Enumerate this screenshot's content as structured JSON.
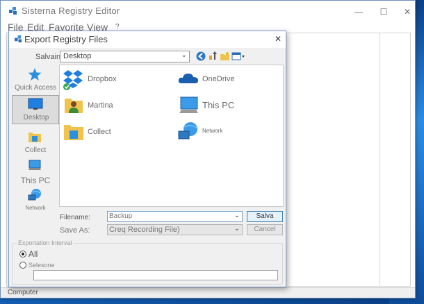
{
  "main_window": {
    "title": "Sisterna Registry Editor",
    "menu": [
      "File",
      "Edit",
      "Favorite",
      "View",
      "?"
    ],
    "controls": {
      "minimize": "—",
      "maximize": "☐",
      "close": "✕"
    },
    "status": "Computer"
  },
  "dialog": {
    "title": "Export Registry Files",
    "close": "✕",
    "save_in_label": "Salvain",
    "save_in_value": "Desktop",
    "places": [
      {
        "label": "Quick Access",
        "icon": "star-icon"
      },
      {
        "label": "Desktop",
        "icon": "desktop-icon"
      },
      {
        "label": "Collect",
        "icon": "library-icon"
      },
      {
        "label": "This PC",
        "icon": "computer-icon"
      },
      {
        "label": "Network",
        "icon": "network-icon"
      }
    ],
    "files": [
      {
        "label": "Dropbox",
        "icon": "dropbox-icon"
      },
      {
        "label": "OneDrive",
        "icon": "onedrive-icon"
      },
      {
        "label": "Martina",
        "icon": "user-folder-icon"
      },
      {
        "label": "This PC",
        "icon": "computer-icon"
      },
      {
        "label": "Collect",
        "icon": "library-icon"
      },
      {
        "label": "Network",
        "icon": "network-icon"
      }
    ],
    "filename_label": "Filename:",
    "filename_value": "Backup",
    "save_as_label": "Save As:",
    "save_as_value": "Creq Recording File)",
    "save_button": "Salva",
    "cancel_button": "Cancel",
    "interval_legend": "Exportation Interval",
    "option_all": "All",
    "option_selected": "Selesone",
    "branch_value": ""
  },
  "colors": {
    "desktop": "#1565b8",
    "accent": "#3c7fb1",
    "folder": "#f0c44c"
  }
}
